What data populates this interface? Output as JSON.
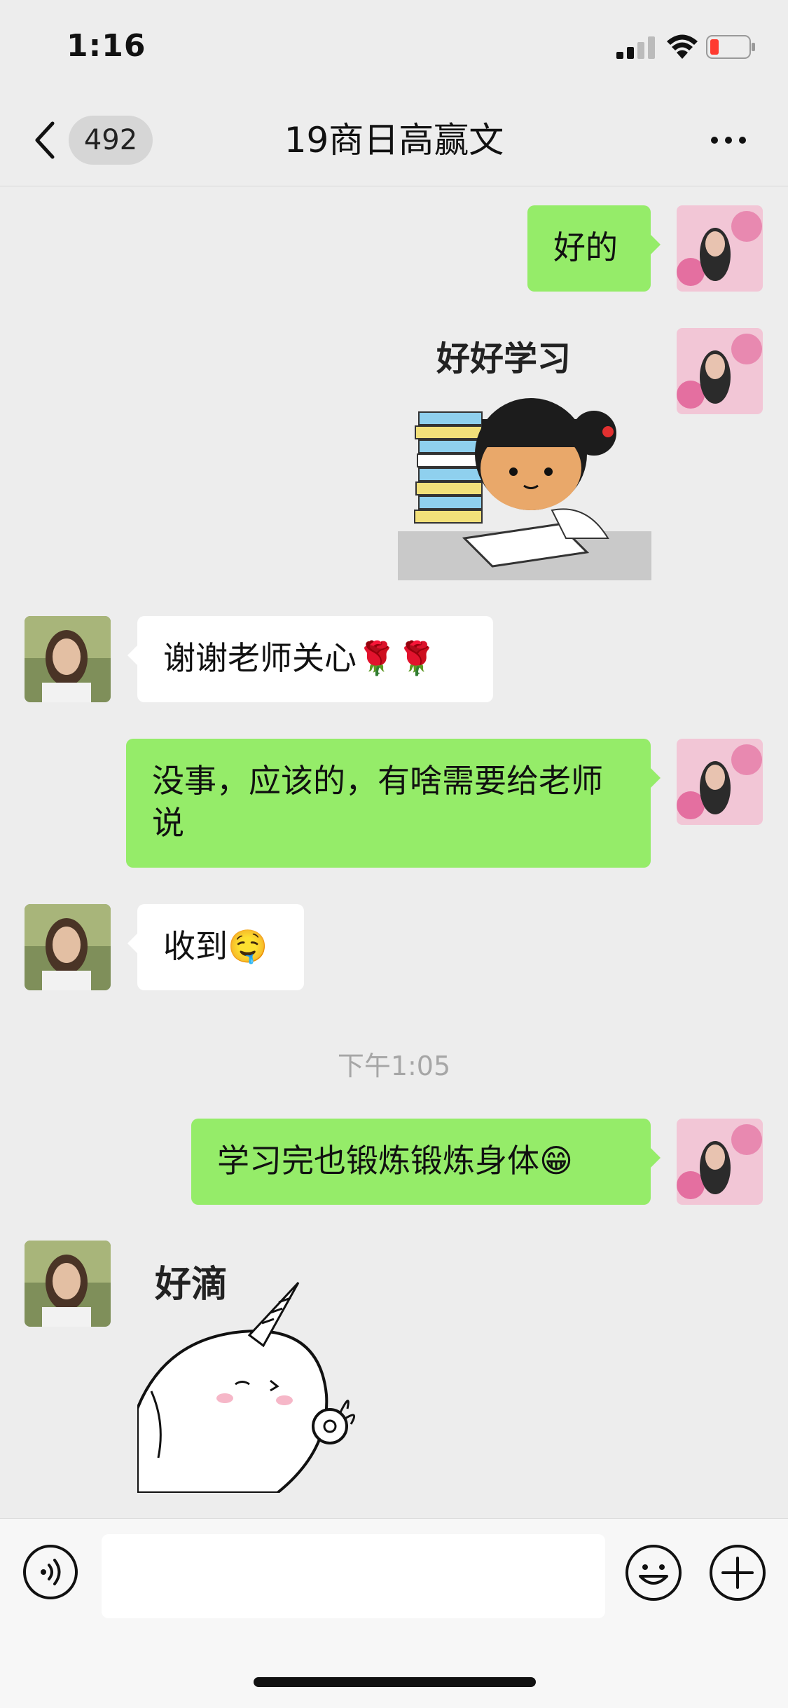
{
  "status_bar": {
    "time": "1:16"
  },
  "nav": {
    "unread_count": "492",
    "title": "19商日高赢文"
  },
  "messages": [
    {
      "side": "right",
      "type": "text",
      "text": "好的"
    },
    {
      "side": "right",
      "type": "sticker",
      "caption": "好好学习"
    },
    {
      "side": "left",
      "type": "text",
      "text": "谢谢老师关心🌹🌹"
    },
    {
      "side": "right",
      "type": "text",
      "text": "没事，应该的，有啥需要给老师说"
    },
    {
      "side": "left",
      "type": "text",
      "text": "收到🤤"
    },
    {
      "side": "right",
      "type": "text",
      "text": "学习完也锻炼锻炼身体😁"
    },
    {
      "side": "left",
      "type": "sticker",
      "caption": "好滴"
    }
  ],
  "timestamp": "下午1:05",
  "icons": {
    "back": "chevron-left-icon",
    "more": "more-dots-icon",
    "voice": "voice-icon",
    "emoji": "emoji-icon",
    "plus": "plus-icon"
  },
  "colors": {
    "sent_bubble": "#95ec69",
    "received_bubble": "#ffffff",
    "background": "#ededed"
  }
}
